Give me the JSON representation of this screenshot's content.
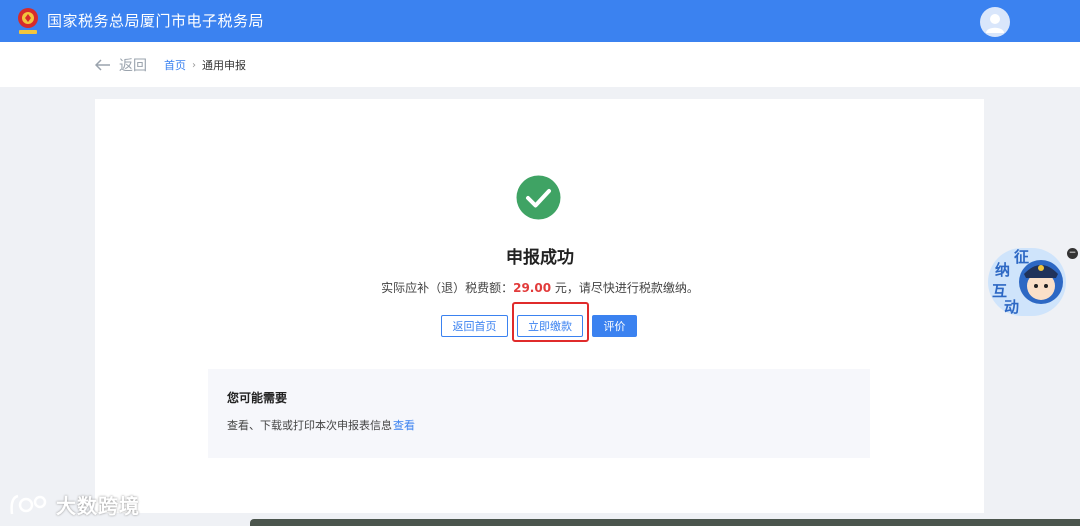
{
  "header": {
    "title": "国家税务总局厦门市电子税务局",
    "user_name": "",
    "brand_color": "#3b82f0"
  },
  "nav": {
    "back_label": "返回",
    "breadcrumb": {
      "home": "首页",
      "current": "通用申报"
    }
  },
  "result": {
    "title": "申报成功",
    "amount_prefix": "实际应补（退）税费额：",
    "amount": "29.00",
    "amount_suffix": " 元，请尽快进行税款缴纳。",
    "amount_color": "#e23b3b"
  },
  "actions": {
    "home_label": "返回首页",
    "pay_label": "立即缴款",
    "rate_label": "评价"
  },
  "suggest": {
    "title": "您可能需要",
    "text": "查看、下载或打印本次申报表信息",
    "link": "查看"
  },
  "widget": {
    "chars": [
      "征",
      "纳",
      "互",
      "动"
    ]
  },
  "watermark": {
    "text": "大数跨境"
  }
}
